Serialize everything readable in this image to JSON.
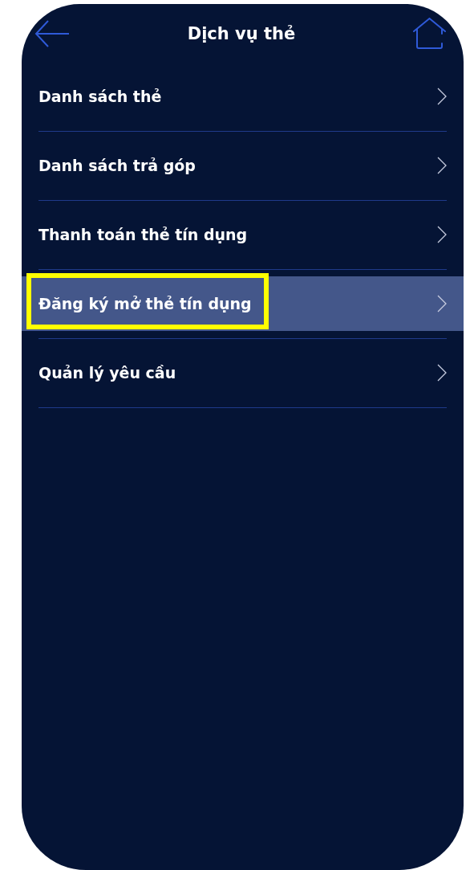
{
  "header": {
    "title": "Dịch vụ thẻ"
  },
  "items": [
    {
      "label": "Danh sách thẻ",
      "selected": false
    },
    {
      "label": "Danh sách trả góp",
      "selected": false
    },
    {
      "label": "Thanh toán thẻ tín dụng",
      "selected": false
    },
    {
      "label": "Đăng ký mở thẻ tín dụng",
      "selected": true
    },
    {
      "label": "Quản lý yêu cầu",
      "selected": false
    }
  ]
}
